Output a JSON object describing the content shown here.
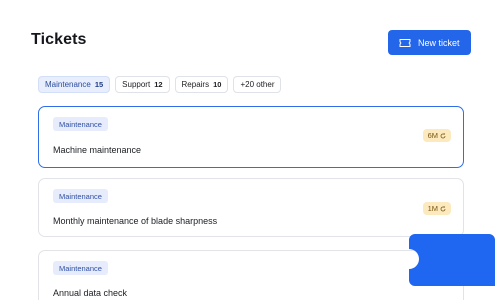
{
  "header": {
    "title": "Tickets",
    "new_ticket_label": "New ticket"
  },
  "filters": [
    {
      "label": "Maintenance",
      "count": "15",
      "active": true
    },
    {
      "label": "Support",
      "count": "12",
      "active": false
    },
    {
      "label": "Repairs",
      "count": "10",
      "active": false
    },
    {
      "label": "+20 other",
      "count": "",
      "active": false
    }
  ],
  "tickets": [
    {
      "tag": "Maintenance",
      "title": "Machine maintenance",
      "badge": "6M",
      "selected": true
    },
    {
      "tag": "Maintenance",
      "title": "Monthly maintenance of blade sharpness",
      "badge": "1M",
      "selected": false
    },
    {
      "tag": "Maintenance",
      "title": "Annual data check",
      "badge": "",
      "selected": false
    }
  ],
  "colors": {
    "accent": "#2466ea",
    "chip_active_bg": "#e8eefc",
    "tag_bg": "#e6ecfb",
    "badge_bg": "#fce9bd",
    "ticket_graphic": "#1f66f0"
  }
}
